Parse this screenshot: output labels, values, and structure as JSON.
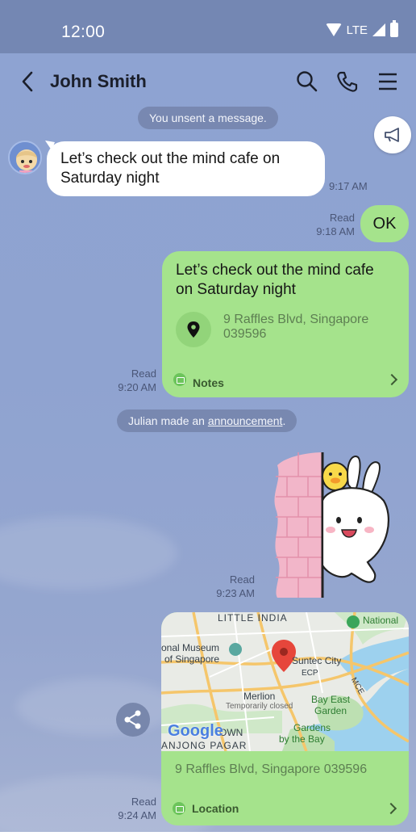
{
  "status_bar": {
    "time": "12:00",
    "network": "LTE"
  },
  "header": {
    "title": "John Smith"
  },
  "system_messages": {
    "unsent": "You unsent a message.",
    "announcement_prefix": "Julian made an ",
    "announcement_link": "announcement",
    "announcement_suffix": "."
  },
  "messages": {
    "incoming_1": {
      "line1": "Let’s check out the mind cafe on",
      "line2": "Saturday night",
      "time": "9:17 AM"
    },
    "outgoing_ok": {
      "text": "OK",
      "read": "Read",
      "time": "9:18 AM"
    },
    "outgoing_note": {
      "line1": "Let’s check out the mind cafe",
      "line2": "on Saturday night",
      "address_line1": "9 Raffles Blvd, Singapore",
      "address_line2": "039596",
      "footer": "Notes",
      "read": "Read",
      "time": "9:20 AM"
    },
    "sticker": {
      "read": "Read",
      "time": "9:23 AM"
    },
    "location": {
      "address": "9 Raffles Blvd, Singapore 039596",
      "footer": "Location",
      "read": "Read",
      "time": "9:24 AM"
    }
  },
  "map_labels": {
    "little_india": "LITTLE INDIA",
    "national": "National",
    "museum_1": "onal Museum",
    "museum_2": "of Singapore",
    "suntec": "Suntec City",
    "ecp": "ECP",
    "merlion": "Merlion",
    "closed": "Temporarily closed",
    "bay_east_1": "Bay East",
    "bay_east_2": "Garden",
    "gardens_1": "Gardens",
    "gardens_2": "by the Bay",
    "google": "Google",
    "town": "OWN",
    "tanjong": "ANJONG PAGAR",
    "mce": "MCE"
  },
  "colors": {
    "bubble_out": "#a5e38c",
    "bubble_in": "#ffffff",
    "background": "#8fa2cf"
  }
}
